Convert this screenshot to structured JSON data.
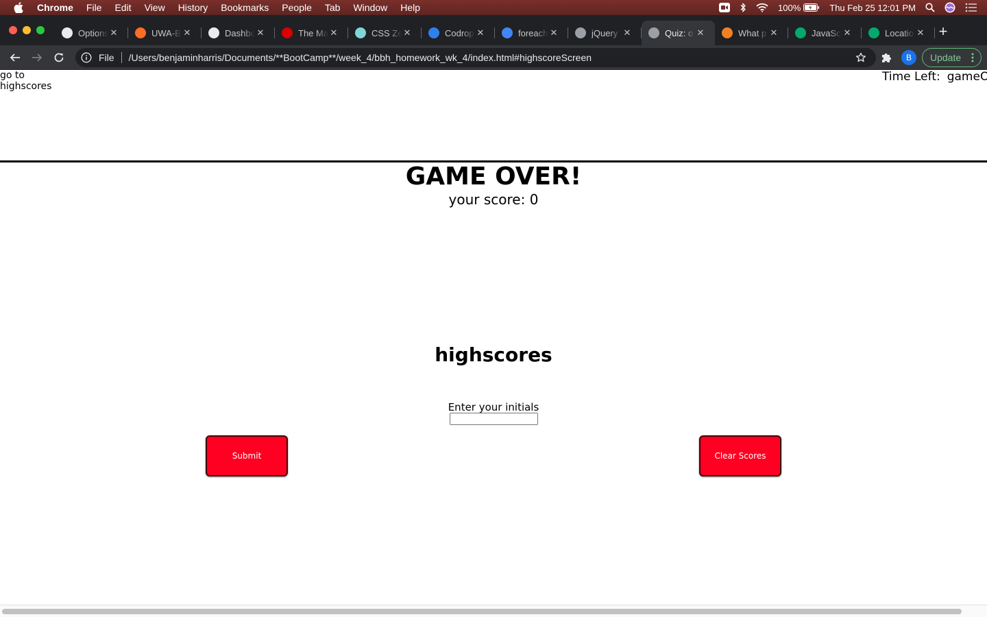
{
  "menubar": {
    "app": "Chrome",
    "items": [
      "File",
      "Edit",
      "View",
      "History",
      "Bookmarks",
      "People",
      "Tab",
      "Window",
      "Help"
    ],
    "battery": "100%",
    "datetime": "Thu Feb 25  12:01 PM"
  },
  "tabs": [
    {
      "title": "Options",
      "icon": "github-icon",
      "color": "#e8eaed"
    },
    {
      "title": "UWA-B",
      "icon": "gitlab-icon",
      "color": "#fc6d26"
    },
    {
      "title": "Dashbo",
      "icon": "globe-icon",
      "color": "#e8eaed"
    },
    {
      "title": "The Ma",
      "icon": "hub-icon",
      "color": "#d80000"
    },
    {
      "title": "CSS Ze",
      "icon": "csszengarden-icon",
      "color": "#7fd6d6"
    },
    {
      "title": "Codrop",
      "icon": "codrops-icon",
      "color": "#2f80ed"
    },
    {
      "title": "foreach",
      "icon": "google-icon",
      "color": "#4285f4"
    },
    {
      "title": "jQuery",
      "icon": "globe-icon",
      "color": "#9aa0a6"
    },
    {
      "title": "Quiz: o",
      "icon": "globe-icon",
      "color": "#9aa0a6",
      "active": true
    },
    {
      "title": "What p",
      "icon": "stackoverflow-icon",
      "color": "#f48024"
    },
    {
      "title": "JavaSc",
      "icon": "w3schools-icon",
      "color": "#04aa6d"
    },
    {
      "title": "Locatio",
      "icon": "w3schools-icon",
      "color": "#04aa6d"
    }
  ],
  "toolbar": {
    "scheme": "File",
    "url": "/Users/benjaminharris/Documents/**BootCamp**/week_4/bbh_homework_wk_4/index.html#highscoreScreen",
    "profile_initial": "B",
    "update_label": "Update"
  },
  "page": {
    "highscores_link": "go to highscores",
    "timer_label": "Time Left:",
    "timer_value": "gameO",
    "game_over": "GAME OVER!",
    "score_text": "your score: 0",
    "highscores_title": "highscores",
    "initials_label": "Enter your initials",
    "initials_value": "",
    "submit_label": "Submit",
    "clear_label": "Clear Scores"
  },
  "colors": {
    "button_red": "#ff0022",
    "chrome_dark": "#202124",
    "menubar_bg": "#6a2d2a"
  }
}
